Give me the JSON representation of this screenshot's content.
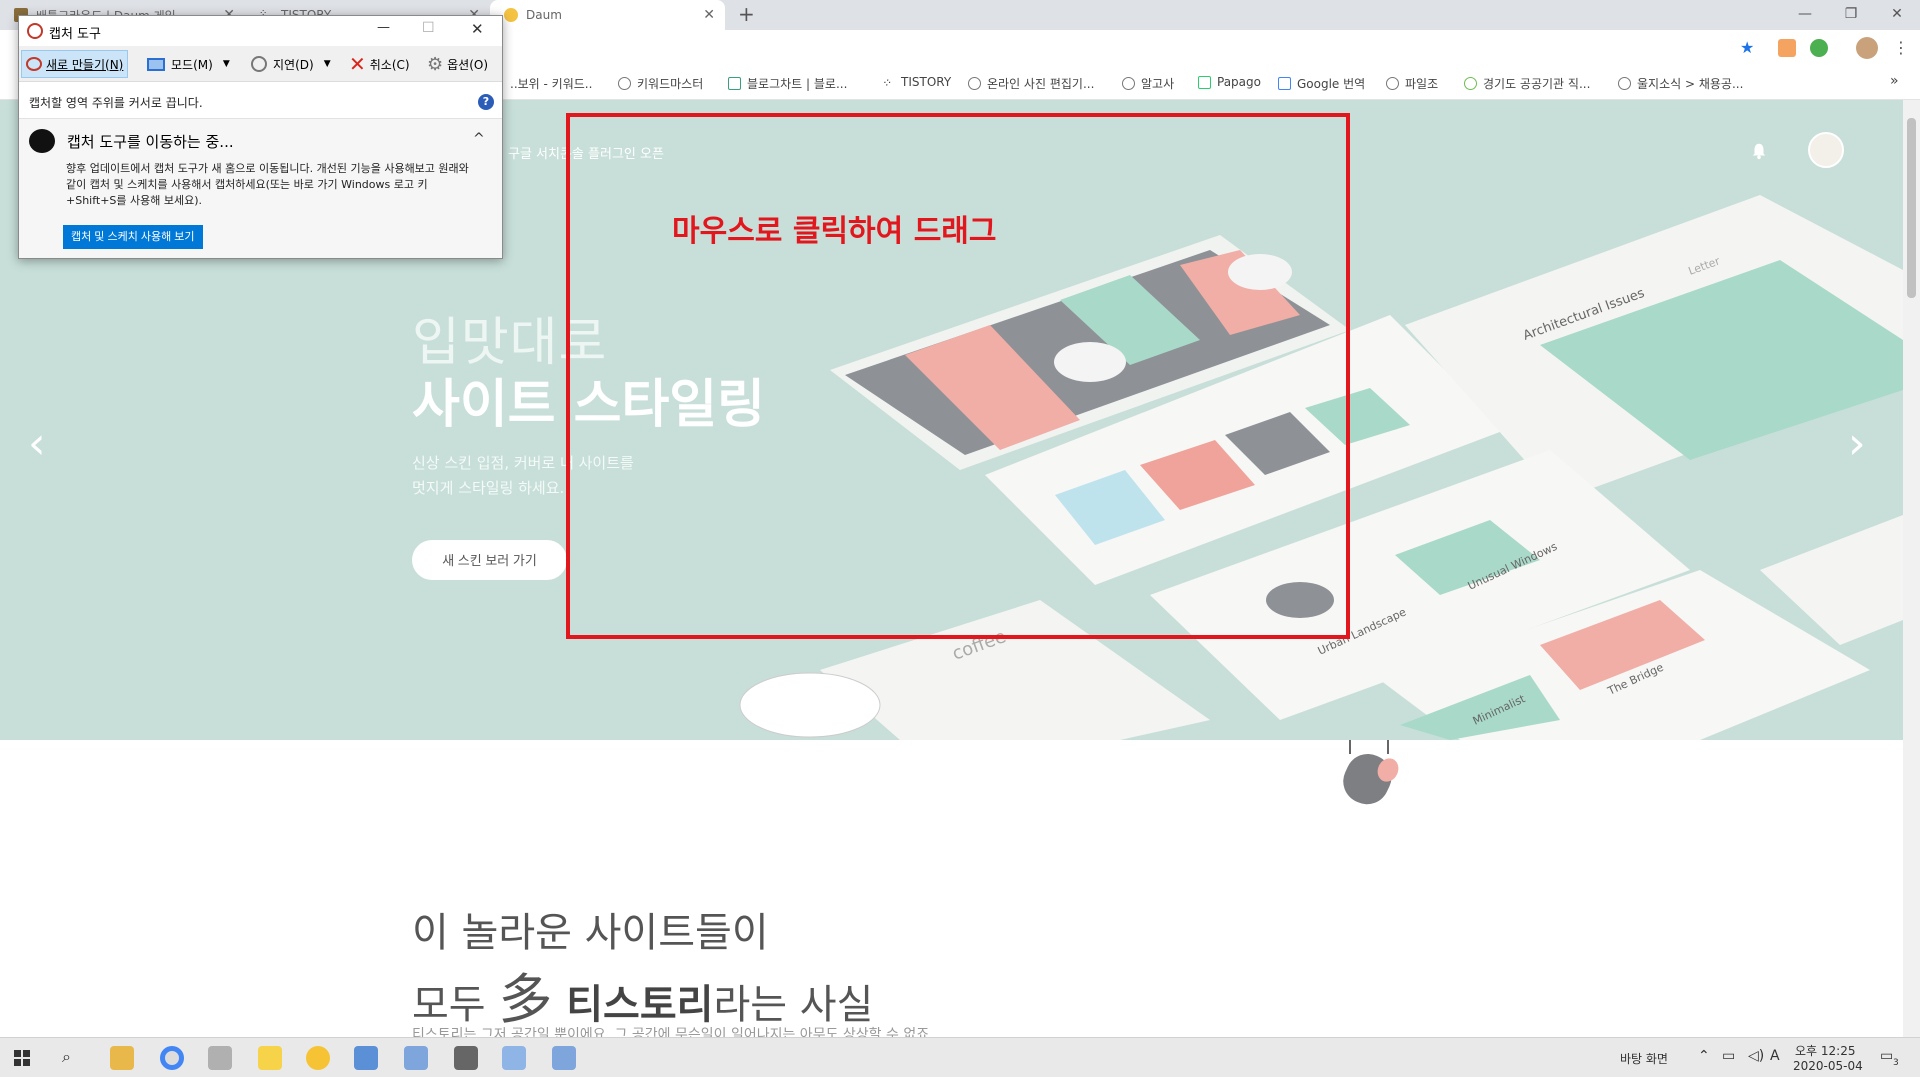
{
  "browser": {
    "tabs": [
      {
        "title": "배틀그라운드 | Daum 게임"
      },
      {
        "title": "TISTORY"
      },
      {
        "title": "Daum",
        "active": true
      }
    ],
    "new_tab": "+",
    "controls": {
      "minimize": "—",
      "maximize": "❐",
      "close": "✕"
    },
    "bookmarks": [
      "키워드마스터",
      "블로그차트 | 블로...",
      "TISTORY",
      "온라인 사진 편집기...",
      "알고사",
      "Papago",
      "Google 번역",
      "파일조",
      "경기도 공공기관 직...",
      "울지소식 > 채용공..."
    ],
    "bookmark_partial": "..보위 - 키워드..",
    "bookmarks_more": "»"
  },
  "page": {
    "nav_text": "구글 서치콘솔 플러그인 오픈",
    "hero": {
      "title1": "입맛대로",
      "title2": "사이트 스타일링",
      "desc1": "신상 스킨 입점, 커버로 내 사이트를",
      "desc2": "멋지게 스타일링 하세요.",
      "button": "새 스킨 보러 가기",
      "prev": "‹",
      "next": "›"
    },
    "section2": {
      "title1": "이 놀라운 사이트들이",
      "title2_prefix": "모두 ",
      "title2_han": "多",
      "title2_bold": " 티스토리",
      "title2_suffix": "라는 사실",
      "desc": "티스토리는 그저 공간일 뿐이에요. 그 공간에 무슨일이 일어나지는 아무도 상상할 수 없죠"
    },
    "illustration_labels": {
      "architectural": "Architectural Issues",
      "letter": "Letter",
      "coffee": "coffee",
      "urban": "Urban Landscape",
      "unusual": "Unusual Windows",
      "bridge": "The Bridge",
      "minimalist": "Minimalist"
    }
  },
  "annotation": {
    "label": "마우스로 클릭하여 드래그",
    "color": "#e2161d"
  },
  "snipping_tool": {
    "title": "캡처 도구",
    "toolbar": {
      "new": "새로 만들기(N)",
      "mode": "모드(M)",
      "delay": "지연(D)",
      "cancel": "취소(C)",
      "options": "옵션(O)"
    },
    "hint": "캡처할 영역 주위를 커서로 끕니다.",
    "help": "?",
    "panel": {
      "title": "캡처 도구를 이동하는 중...",
      "body": "향후 업데이트에서 캡처 도구가 새 홈으로 이동됩니다. 개선된 기능을 사용해보고 원래와 같이 캡처 및 스케치를 사용해서 캡처하세요(또는 바로 가기 Windows 로고 키+Shift+S를 사용해 보세요).",
      "button": "캡처 및 스케치 사용해 보기",
      "collapse": "^"
    },
    "window_controls": {
      "minimize": "—",
      "maximize": "☐",
      "close": "✕"
    }
  },
  "taskbar": {
    "desktop_label": "바탕 화면",
    "time": "오후 12:25",
    "date": "2020-05-04",
    "ime": "A",
    "notifications": "3"
  }
}
